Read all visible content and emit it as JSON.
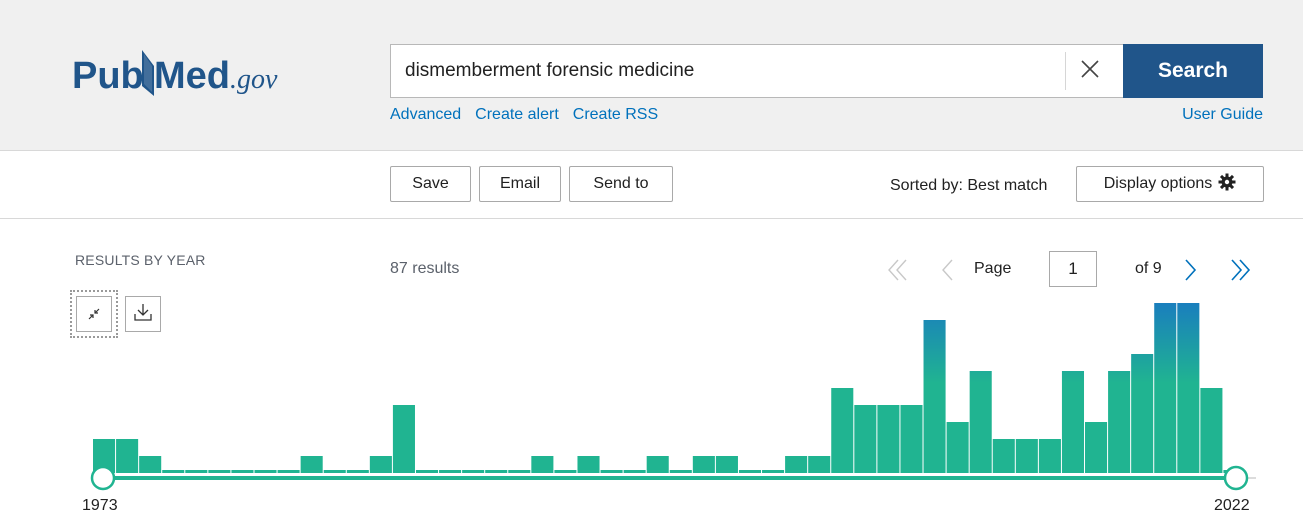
{
  "header": {
    "logo": {
      "text_pub": "Pub",
      "text_med": "Med",
      "text_gov": ".gov"
    },
    "search": {
      "value": "dismemberment forensic medicine",
      "button_label": "Search"
    },
    "links": {
      "advanced": "Advanced",
      "create_alert": "Create alert",
      "create_rss": "Create RSS",
      "user_guide": "User Guide"
    }
  },
  "toolbar": {
    "save": "Save",
    "email": "Email",
    "send_to": "Send to",
    "sorted_by": "Sorted by: Best match",
    "display_options": "Display options"
  },
  "results": {
    "by_year_label": "RESULTS BY YEAR",
    "count": "87 results"
  },
  "pagination": {
    "page_label": "Page",
    "page_value": "1",
    "of_label": "of 9"
  },
  "icons": {
    "clear": "close-icon",
    "display_options": "gear-icon",
    "collapse": "collapse-icon",
    "download": "download-icon",
    "first": "double-chevron-left-icon",
    "prev": "chevron-left-icon",
    "next": "chevron-right-icon",
    "last": "double-chevron-right-icon"
  },
  "colors": {
    "brand_blue": "#20558a",
    "link_blue": "#0071bc",
    "bar_green": "#20b491",
    "bar_blue": "#1a7fbd"
  },
  "chart_data": {
    "type": "bar",
    "x": [
      1973,
      1974,
      1975,
      1976,
      1977,
      1978,
      1979,
      1980,
      1981,
      1982,
      1983,
      1984,
      1985,
      1986,
      1987,
      1988,
      1989,
      1990,
      1991,
      1992,
      1993,
      1994,
      1995,
      1996,
      1997,
      1998,
      1999,
      2000,
      2001,
      2002,
      2003,
      2004,
      2005,
      2006,
      2007,
      2008,
      2009,
      2010,
      2011,
      2012,
      2013,
      2014,
      2015,
      2016,
      2017,
      2018,
      2019,
      2020,
      2021,
      2022
    ],
    "values": [
      2,
      2,
      1,
      0,
      0,
      0,
      0,
      0,
      0,
      1,
      0,
      0,
      1,
      4,
      0,
      0,
      0,
      0,
      0,
      1,
      0,
      1,
      0,
      0,
      1,
      0,
      1,
      1,
      0,
      0,
      1,
      1,
      5,
      4,
      4,
      4,
      9,
      3,
      6,
      2,
      2,
      2,
      6,
      3,
      6,
      7,
      10,
      10,
      5,
      0
    ],
    "start_label": "1973",
    "end_label": "2022"
  }
}
